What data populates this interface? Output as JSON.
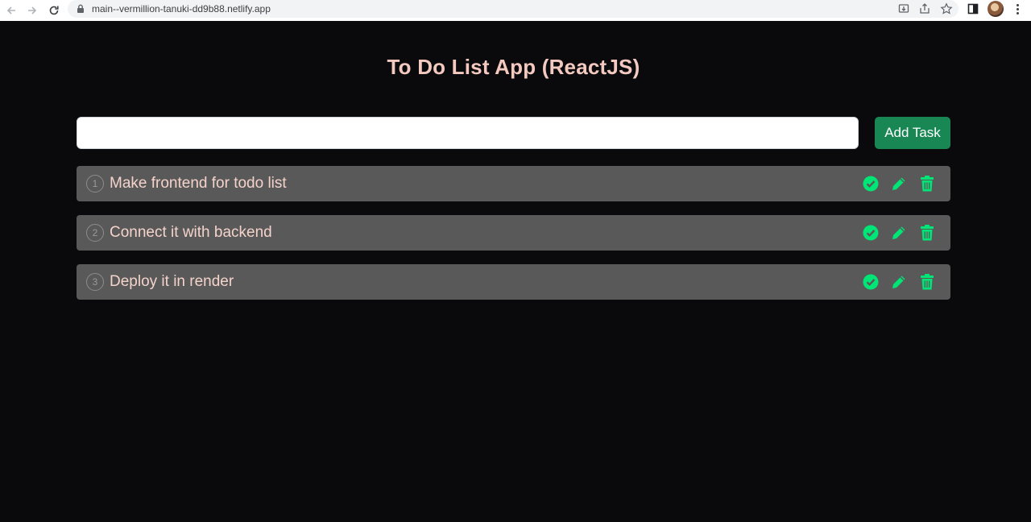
{
  "browser": {
    "url": "main--vermillion-tanuki-dd9b88.netlify.app"
  },
  "app": {
    "title": "To Do List App (ReactJS)",
    "input": {
      "value": "",
      "placeholder": ""
    },
    "add_button_label": "Add Task",
    "accent_color": "#00e676",
    "tasks": [
      {
        "number": "1",
        "text": "Make frontend for todo list"
      },
      {
        "number": "2",
        "text": "Connect it with backend"
      },
      {
        "number": "3",
        "text": "Deploy it in render"
      }
    ]
  }
}
